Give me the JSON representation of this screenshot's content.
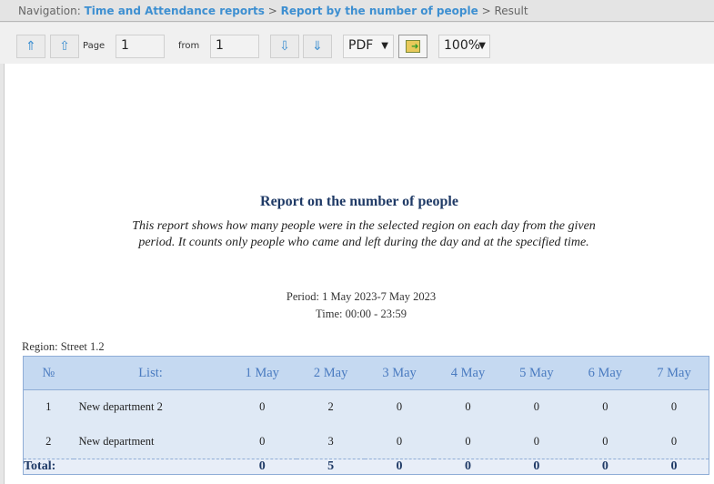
{
  "nav": {
    "prefix": "Navigation:",
    "crumbs": [
      "Time and Attendance reports",
      "Report by the number of people"
    ],
    "sep": ">",
    "current": "Result"
  },
  "toolbar": {
    "first_icon": "⇑",
    "prev_icon": "⇧",
    "page_label": "Page",
    "page_value": "1",
    "from_label": "from",
    "from_value": "1",
    "next_icon": "⇩",
    "last_icon": "⇓",
    "format": "PDF",
    "export_icon": "export-icon",
    "zoom": "100%"
  },
  "report": {
    "title": "Report on the number of people",
    "description": "This report shows how many people were in the selected region on each day from the given period. It counts only people who came and left during the day and at the specified time.",
    "period": "Period: 1 May 2023-7 May 2023",
    "time": "Time: 00:00 - 23:59",
    "region": "Region: Street 1.2"
  },
  "table": {
    "headers": [
      "№",
      "List:",
      "1 May",
      "2 May",
      "3 May",
      "4 May",
      "5 May",
      "6 May",
      "7 May"
    ],
    "rows": [
      [
        "1",
        "New department 2",
        "0",
        "2",
        "0",
        "0",
        "0",
        "0",
        "0"
      ],
      [
        "2",
        "New department",
        "0",
        "3",
        "0",
        "0",
        "0",
        "0",
        "0"
      ]
    ],
    "total": [
      "Total:",
      "0",
      "5",
      "0",
      "0",
      "0",
      "0",
      "0"
    ]
  }
}
